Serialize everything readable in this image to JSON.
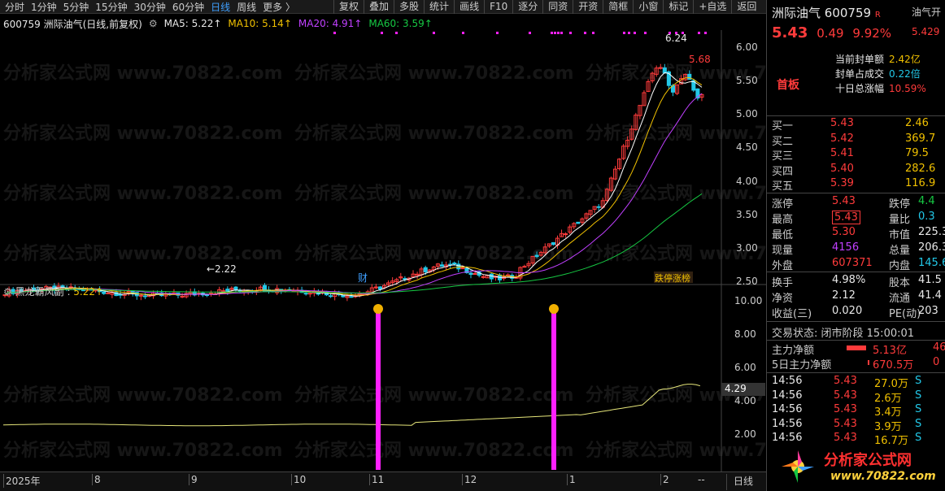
{
  "toolbar": {
    "periods": [
      "分时",
      "1分钟",
      "5分钟",
      "15分钟",
      "30分钟",
      "60分钟",
      "日线",
      "周线",
      "更多 〉"
    ],
    "active_period": "日线",
    "buttons": [
      "复权",
      "叠加",
      "多股",
      "统计",
      "画线",
      "F10",
      "逐分",
      "同资",
      "开资",
      "简框",
      "小窗",
      "标记",
      "+自选",
      "返回"
    ]
  },
  "legend": {
    "title": "600759 洲际油气(日线,前复权)",
    "ma5": "MA5: 5.22↑",
    "ma10": "MA10: 5.14↑",
    "ma20": "MA20: 4.91↑",
    "ma60": "MA60: 3.59↑"
  },
  "main_chart": {
    "y_ticks": [
      "6.00",
      "5.50",
      "5.00",
      "4.50",
      "4.00",
      "3.50",
      "3.00",
      "2.50"
    ],
    "high_label": "6.24",
    "recent_label": "5.68",
    "low_label": "2.22",
    "marker_cai": "财",
    "marker_list": "跌停涨榜"
  },
  "indicator": {
    "title": "黑龙霸风副",
    "value": "5.22↑",
    "y_ticks": [
      "10.00",
      "8.00",
      "6.00",
      "4.00",
      "2.00"
    ],
    "current": "4.29"
  },
  "x_axis": {
    "labels": [
      "2025年",
      "8",
      "9",
      "10",
      "11",
      "12",
      "1",
      "2"
    ],
    "period_btn": "日线",
    "more": "--"
  },
  "chart_data": {
    "type": "line",
    "title": "600759 洲际油气(日线,前复权)",
    "x": [
      "2025-07",
      "2025-08",
      "2025-09",
      "2025-10",
      "2025-11",
      "2025-12",
      "2026-01",
      "2026-02"
    ],
    "series": [
      {
        "name": "MA60",
        "values": [
          2.32,
          2.33,
          2.36,
          2.38,
          2.45,
          2.56,
          2.85,
          3.59
        ]
      },
      {
        "name": "MA20",
        "values": [
          2.35,
          2.36,
          2.38,
          2.4,
          2.55,
          2.7,
          3.4,
          4.91
        ]
      }
    ],
    "ylim": [
      2.2,
      6.3
    ],
    "annotations": [
      "6.24",
      "5.68",
      "2.22"
    ]
  },
  "quote": {
    "name": "洲际油气",
    "code": "600759",
    "badge": "R",
    "price": "5.43",
    "change": "0.49",
    "pct": "9.92%",
    "tag": "首板",
    "side_tab": "油气开",
    "side_val": "5.429",
    "stats": [
      {
        "label": "当前封单额",
        "value": "2.42亿"
      },
      {
        "label": "封单占成交",
        "value": "0.22倍"
      },
      {
        "label": "十日总涨幅",
        "value": "10.59%"
      }
    ]
  },
  "orderbook": [
    {
      "name": "买一",
      "price": "5.43",
      "vol": "2.46"
    },
    {
      "name": "买二",
      "price": "5.42",
      "vol": "369.7"
    },
    {
      "name": "买三",
      "price": "5.41",
      "vol": "79.5"
    },
    {
      "name": "买四",
      "price": "5.40",
      "vol": "282.6"
    },
    {
      "name": "买五",
      "price": "5.39",
      "vol": "116.9"
    }
  ],
  "quotes": [
    {
      "l1": "涨停",
      "v1": "5.43",
      "l2": "跌停",
      "v2": "4.4"
    },
    {
      "l1": "最高",
      "v1": "5.43",
      "l2": "量比",
      "v2": "0.3"
    },
    {
      "l1": "最低",
      "v1": "5.30",
      "l2": "市值",
      "v2": "225.3"
    },
    {
      "l1": "现量",
      "v1": "4156",
      "l2": "总量",
      "v2": "206.3"
    },
    {
      "l1": "外盘",
      "v1": "607371",
      "l2": "内盘",
      "v2": "145.6"
    }
  ],
  "fundamentals": [
    {
      "l1": "换手",
      "v1": "4.98%",
      "l2": "股本",
      "v2": "41.5"
    },
    {
      "l1": "净资",
      "v1": "2.12",
      "l2": "流通",
      "v2": "41.4"
    },
    {
      "l1": "收益(三)",
      "v1": "0.020",
      "l2": "PE(动)",
      "v2": "203"
    }
  ],
  "trade_state": "交易状态: 闭市阶段 15:00:01",
  "capital": [
    {
      "label": "主力净额",
      "value": "5.13亿",
      "extra": "46"
    },
    {
      "label": "5日主力净额",
      "value": "670.5万",
      "extra": "0"
    }
  ],
  "ticks": [
    {
      "time": "14:56",
      "price": "5.43",
      "vol": "27.0万",
      "side": "S"
    },
    {
      "time": "14:56",
      "price": "5.43",
      "vol": "2.6万",
      "side": "S"
    },
    {
      "time": "14:56",
      "price": "5.43",
      "vol": "3.4万",
      "side": "S"
    },
    {
      "time": "14:56",
      "price": "5.43",
      "vol": "3.9万",
      "side": "S"
    },
    {
      "time": "14:56",
      "price": "5.43",
      "vol": "16.7万",
      "side": "S"
    }
  ],
  "watermark": "分析家公式网 www.70822.com",
  "logo_text": "分析家公式网",
  "logo_url": "www.70822.com",
  "colors": {
    "up": "#ff3b3b",
    "down": "#22c8e8",
    "ma5": "#ffffff",
    "ma10": "#f0c000",
    "ma20": "#c040ff",
    "ma60": "#16c843",
    "indicator": "#e6e67a",
    "bar": "#ff20ff"
  }
}
